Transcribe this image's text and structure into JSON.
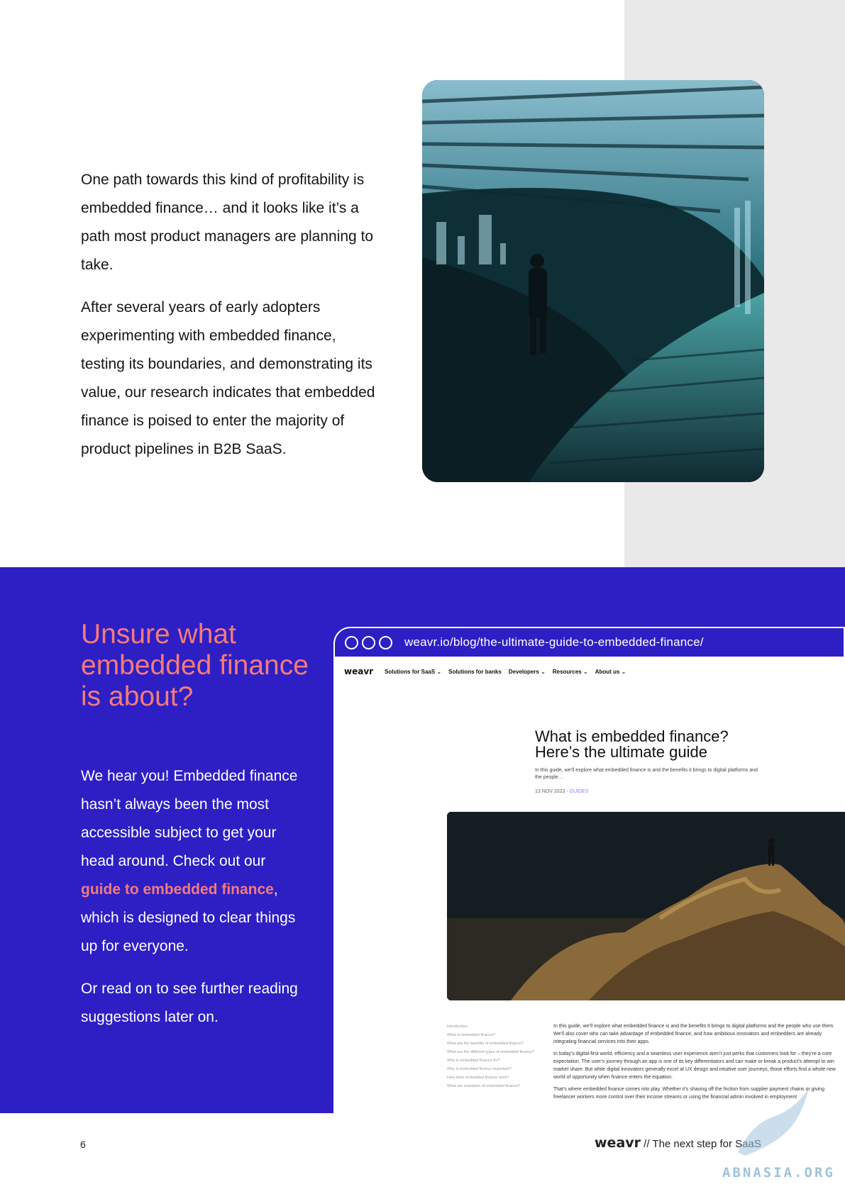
{
  "intro": {
    "paragraphs": [
      "One path towards this kind of profitability is embedded finance… and it looks like it’s a path most product managers are planning to take.",
      "After several years of early adopters experimenting with embedded finance, testing its boundaries, and demonstrating its value, our research indicates that embedded finance is poised to enter the majority of product pipelines in B2B SaaS."
    ]
  },
  "callout": {
    "heading": "Unsure what embedded finance is about?",
    "p1_a": "We hear you! Embedded finance hasn’t always been the most accessible subject to get your head around. Check out our ",
    "link": "guide to embedded finance",
    "p1_b": ", which is designed to clear things up for everyone.",
    "p2": "Or read on to see further reading suggestions later on."
  },
  "browser": {
    "url": "weavr.io/blog/the-ultimate-guide-to-embedded-finance/",
    "logo": "weavr",
    "nav": [
      "Solutions for SaaS ⌄",
      "Solutions for banks",
      "Developers ⌄",
      "Resources ⌄",
      "About us ⌄"
    ],
    "title": "What is embedded finance? Here’s the ultimate guide",
    "subtitle": "In this guide, we’ll explore what embedded finance is and the benefits it brings to digital platforms and the people…",
    "date": "13 NOV 2023 -",
    "tag": "GUIDES",
    "toc": [
      "Introduction",
      "What is embedded finance?",
      "What are the benefits of embedded finance?",
      "What are the different types of embedded finance?",
      "Who is embedded finance for?",
      "Why is embedded finance important?",
      "How does embedded finance work?",
      "What are examples of embedded finance?"
    ],
    "body": [
      "In this guide, we’ll explore what embedded finance is and the benefits it brings to digital platforms and the people who use them. We’ll also cover who can take advantage of embedded finance, and how ambitious innovators and embedders are already integrating financial services into their apps.",
      "In today’s digital-first world, efficiency and a seamless user experience aren’t just perks that customers look for – they’re a core expectation. The user’s journey through an app is one of its key differentiators and can make or break a product’s attempt to win market share. But while digital innovators generally excel at UX design and intuitive user journeys, those efforts find a whole new world of opportunity when finance enters the equation.",
      "That’s where embedded finance comes into play. Whether it’s shaving off the friction from supplier payment chains or giving freelancer workers more control over their income streams or using the financial admin involved in employment"
    ]
  },
  "footer": {
    "page_number": "6",
    "brand": "weavr",
    "tagline": " // The next step for SaaS"
  },
  "watermark": "ABNASIA.ORG",
  "colors": {
    "brand_blue": "#2d1fc4",
    "accent_coral": "#f57a7a",
    "grey_strip": "#e9e9ea"
  }
}
